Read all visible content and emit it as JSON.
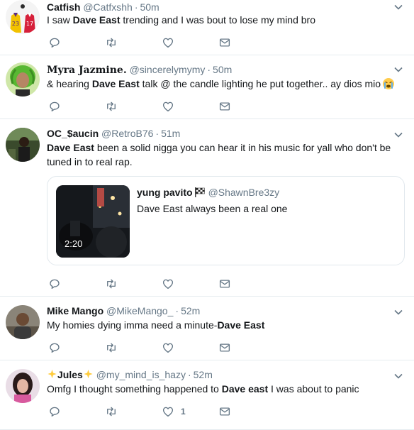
{
  "colors": {
    "text": "#14171a",
    "muted": "#657786",
    "divider": "#e6ecf0",
    "border": "#e1e8ed"
  },
  "tweets": [
    {
      "name": "Catfish",
      "handle": "@Catfxshh",
      "time": "50m",
      "text": {
        "pre": "I saw ",
        "bold": "Dave East",
        "post": " trending and I was bout to lose my mind bro"
      },
      "avatar_icon": "basketball-jerseys-avatar"
    },
    {
      "name": "Myra Jazmine.",
      "handle": "@sincerelymymy",
      "time": "50m",
      "text": {
        "pre": "& hearing ",
        "bold": "Dave East",
        "post": " talk @ the candle lighting he put together.. ay dios mio",
        "emoji": "crying-face-emoji"
      },
      "avatar_icon": "green-hair-avatar"
    },
    {
      "name": "OC_$aucin",
      "handle": "@RetroB76",
      "time": "51m",
      "text": {
        "pre": "",
        "bold": "Dave East",
        "post": " been a solid nigga you can hear it in his music for yall who don't be tuned in to real rap."
      },
      "avatar_icon": "street-photo-avatar",
      "quote": {
        "name": "yung pavito",
        "handle": "@ShawnBre3zy",
        "text": "Dave East always been a real one",
        "duration": "2:20"
      }
    },
    {
      "name": "Mike Mango",
      "handle": "@MikeMango_",
      "time": "52m",
      "text": {
        "pre": "My homies dying imma need a minute-",
        "bold": "Dave East",
        "post": ""
      },
      "avatar_icon": "man-photo-avatar"
    },
    {
      "name": "Jules",
      "handle": "@my_mind_is_hazy",
      "time": "52m",
      "text": {
        "pre": "Omfg I thought something happened to ",
        "bold": "Dave east",
        "post": " I was about to panic"
      },
      "avatar_icon": "woman-photo-avatar",
      "like_count": "1"
    }
  ]
}
